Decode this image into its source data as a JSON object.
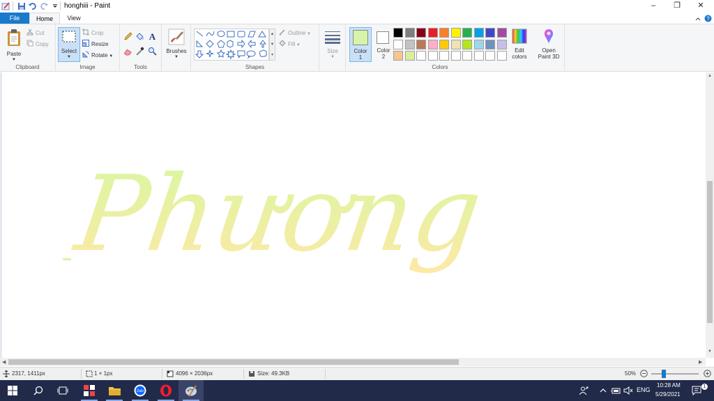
{
  "app": {
    "title": "honghiii - Paint"
  },
  "tabs": {
    "file": "File",
    "home": "Home",
    "view": "View"
  },
  "clipboard": {
    "paste": "Paste",
    "cut": "Cut",
    "copy": "Copy",
    "label": "Clipboard"
  },
  "image": {
    "select": "Select",
    "crop": "Crop",
    "resize": "Resize",
    "rotate": "Rotate",
    "label": "Image"
  },
  "tools": {
    "label": "Tools"
  },
  "brushes": {
    "label": "Brushes"
  },
  "shapes": {
    "outline": "Outline",
    "fill": "Fill",
    "label": "Shapes"
  },
  "size": {
    "label": "Size"
  },
  "colors": {
    "color1_label": "Color\n1",
    "color1_top": "Color",
    "color1_bottom": "1",
    "color2_top": "Color",
    "color2_bottom": "2",
    "edit_top": "Edit",
    "edit_bottom": "colors",
    "paint3d_top": "Open",
    "paint3d_bottom": "Paint 3D",
    "label": "Colors",
    "color1_value": "#d6f5a8",
    "color2_value": "#ffffff",
    "palette_row1": [
      "#000000",
      "#7f7f7f",
      "#880015",
      "#ed1c24",
      "#ff7f27",
      "#fff200",
      "#22b14c",
      "#00a2e8",
      "#3f48cc",
      "#a349a4"
    ],
    "palette_row2": [
      "#ffffff",
      "#c3c3c3",
      "#b97a57",
      "#ffaec9",
      "#ffc90e",
      "#efe4b0",
      "#b5e61d",
      "#99d9ea",
      "#7092be",
      "#c8bfe7"
    ],
    "palette_row3": [
      "#f7c58f",
      "#d9ef9c",
      "#ffffff",
      "#ffffff",
      "#ffffff",
      "#ffffff",
      "#ffffff",
      "#ffffff",
      "#ffffff",
      "#ffffff"
    ]
  },
  "canvas": {
    "artwork_text": "Phương",
    "gradient_top": "#d8f7a0",
    "gradient_bottom": "#fde9a6"
  },
  "status": {
    "cursor_pos": "2317, 1411px",
    "selection_size": "1 × 1px",
    "image_size": "4096 × 2036px",
    "file_size": "Size: 49.3KB",
    "zoom": "50%"
  },
  "taskbar": {
    "lang": "ENG",
    "time": "10:28 AM",
    "date": "5/29/2021"
  }
}
